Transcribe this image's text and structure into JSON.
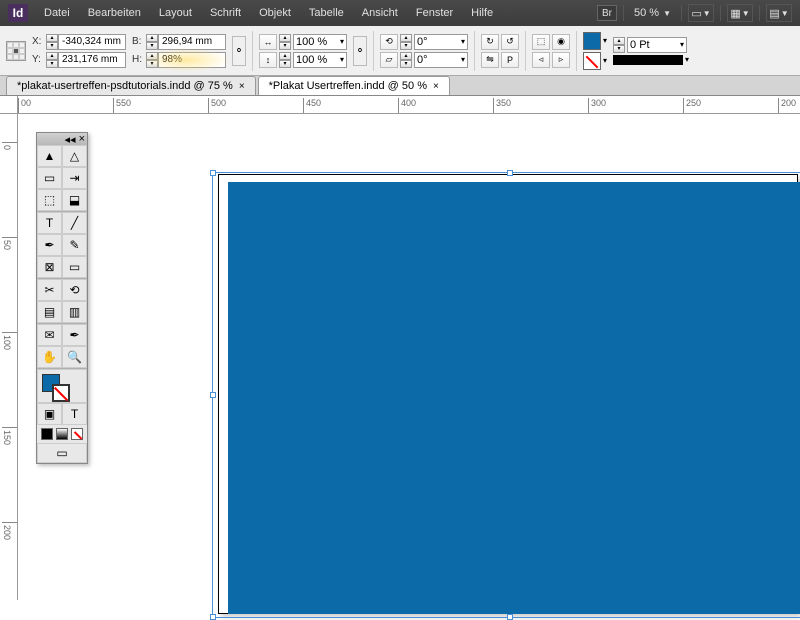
{
  "app": {
    "logo": "Id"
  },
  "menu": [
    "Datei",
    "Bearbeiten",
    "Layout",
    "Schrift",
    "Objekt",
    "Tabelle",
    "Ansicht",
    "Fenster",
    "Hilfe"
  ],
  "menubar": {
    "bridge": "Br",
    "zoom": "50 %"
  },
  "control": {
    "x": "-340,324 mm",
    "y": "231,176 mm",
    "w": "296,94 mm",
    "h": "98%",
    "scaleX": "100 %",
    "scaleY": "100 %",
    "rotate": "0°",
    "shear": "0°",
    "stroke": "0 Pt"
  },
  "tabs": [
    {
      "label": "*plakat-usertreffen-psdtutorials.indd @ 75 %",
      "active": false
    },
    {
      "label": "*Plakat Usertreffen.indd @ 50 %",
      "active": true
    }
  ],
  "ruler_h": [
    "00",
    "550",
    "500",
    "450",
    "400",
    "350",
    "300",
    "250",
    "200"
  ],
  "ruler_v": [
    "0",
    "50",
    "100",
    "150",
    "200"
  ],
  "colors": {
    "fill": "#0d6aa8",
    "swatch": "#0d6aa8"
  }
}
